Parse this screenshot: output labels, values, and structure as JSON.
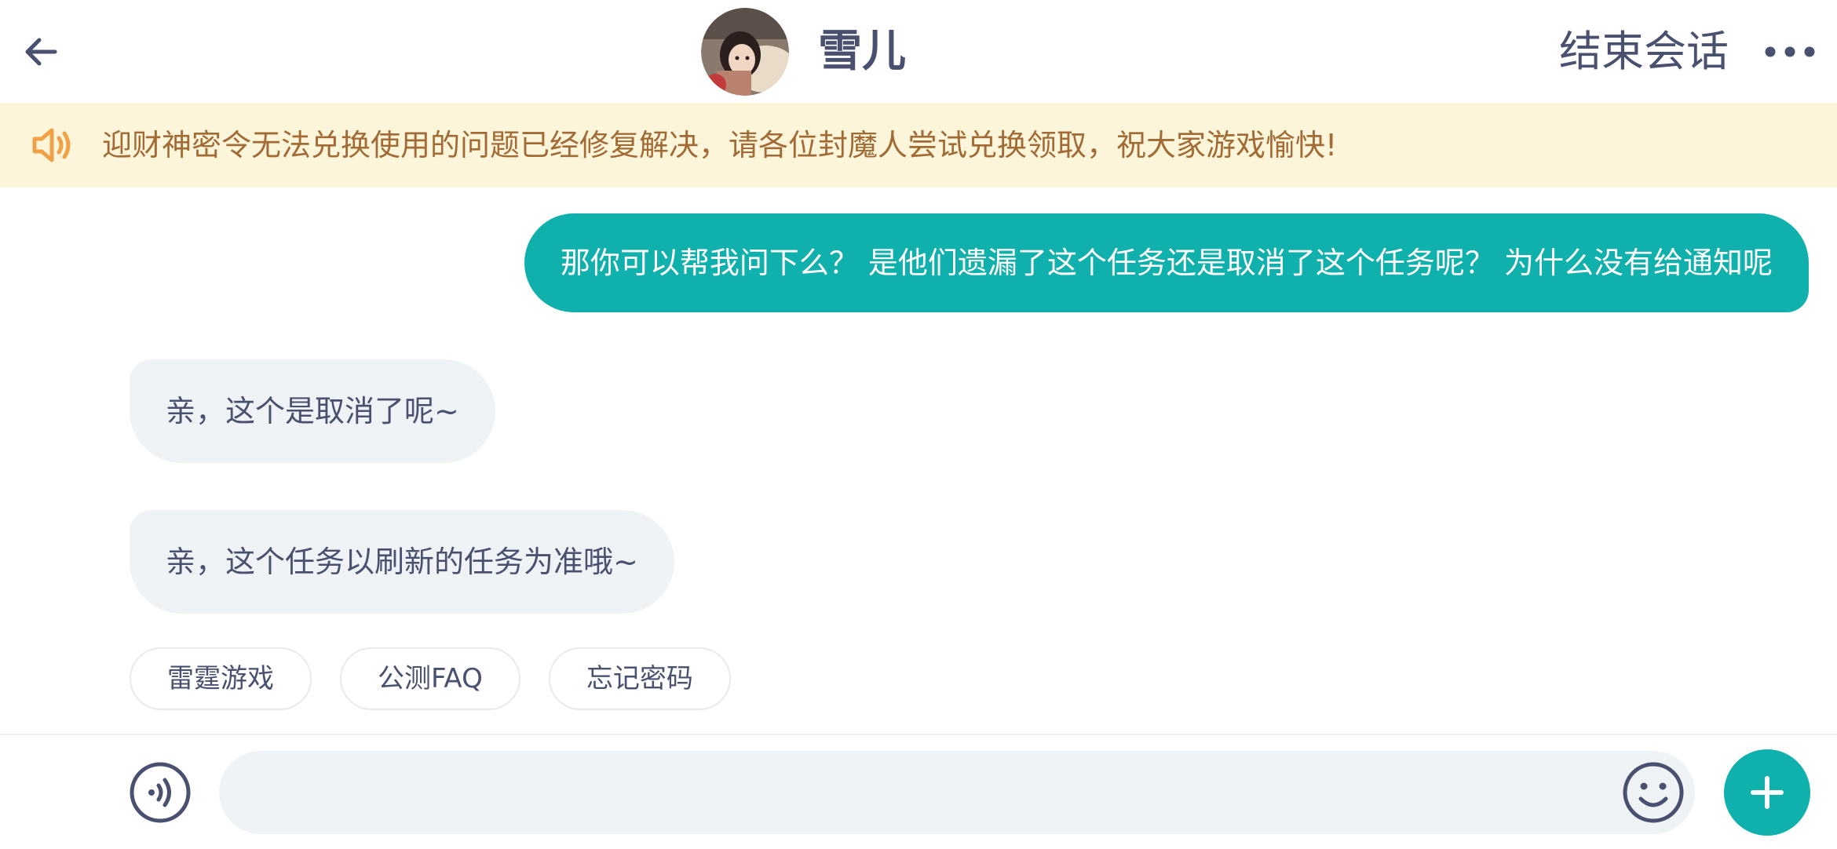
{
  "header": {
    "title": "雪儿",
    "end_chat_label": "结束会话",
    "back_icon": "arrow-left-icon",
    "more_icon": "more-dots-icon",
    "avatar": "contact-avatar-photo"
  },
  "notice": {
    "icon": "speaker-icon",
    "text": "迎财神密令无法兑换使用的问题已经修复解决，请各位封魔人尝试兑换领取，祝大家游戏愉快!",
    "background": "#fdf5da",
    "text_color": "#a26b35"
  },
  "messages": [
    {
      "direction": "outgoing",
      "text": "那你可以帮我问下么？ 是他们遗漏了这个任务还是取消了这个任务呢？ 为什么没有给通知呢"
    },
    {
      "direction": "incoming",
      "text": "亲，这个是取消了呢~"
    },
    {
      "direction": "incoming",
      "text": "亲，这个任务以刷新的任务为准哦~"
    }
  ],
  "quick_replies": [
    "雷霆游戏",
    "公测FAQ",
    "忘记密码"
  ],
  "input": {
    "value": "",
    "placeholder": "",
    "voice_icon": "voice-icon",
    "emoji_icon": "emoji-icon",
    "plus_icon": "plus-icon"
  },
  "colors": {
    "accent": "#10b0ad",
    "text": "#4a5170",
    "incoming_bubble": "#f0f3f6"
  }
}
